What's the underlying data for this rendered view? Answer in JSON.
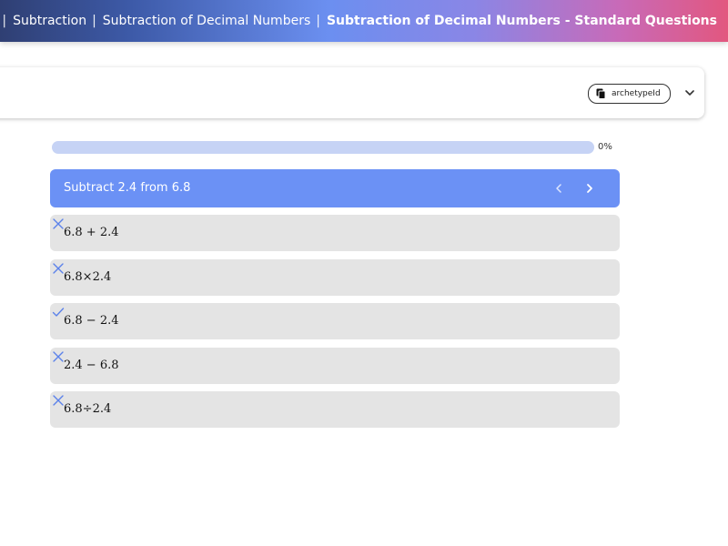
{
  "breadcrumbs": [
    {
      "label": "Subtraction"
    },
    {
      "label": "Subtraction of Decimal Numbers"
    },
    {
      "label": "Subtraction of Decimal Numbers - Standard Questions"
    }
  ],
  "header": {
    "chip_label": "archetypeId",
    "chip_icon": "copy-icon",
    "expand_icon": "chevron-down-icon"
  },
  "progress": {
    "value": 0,
    "label": "0%"
  },
  "question": {
    "text": "Subtract 2.4 from 6.8",
    "prev_icon": "chevron-left-icon",
    "next_icon": "chevron-right-icon"
  },
  "options": [
    {
      "text": "6.8 + 2.4",
      "status": "incorrect",
      "icon": "cross-icon"
    },
    {
      "text": "6.8×2.4",
      "status": "incorrect",
      "icon": "cross-icon"
    },
    {
      "text": "6.8 − 2.4",
      "status": "correct",
      "icon": "check-icon"
    },
    {
      "text": "2.4 − 6.8",
      "status": "incorrect",
      "icon": "cross-icon"
    },
    {
      "text": "6.8÷2.4",
      "status": "incorrect",
      "icon": "cross-icon"
    }
  ],
  "colors": {
    "accent": "#6b91f5",
    "progress_track": "#c6d3f5",
    "option_bg": "#e4e4e4",
    "icon_blue": "#5b82ea"
  }
}
